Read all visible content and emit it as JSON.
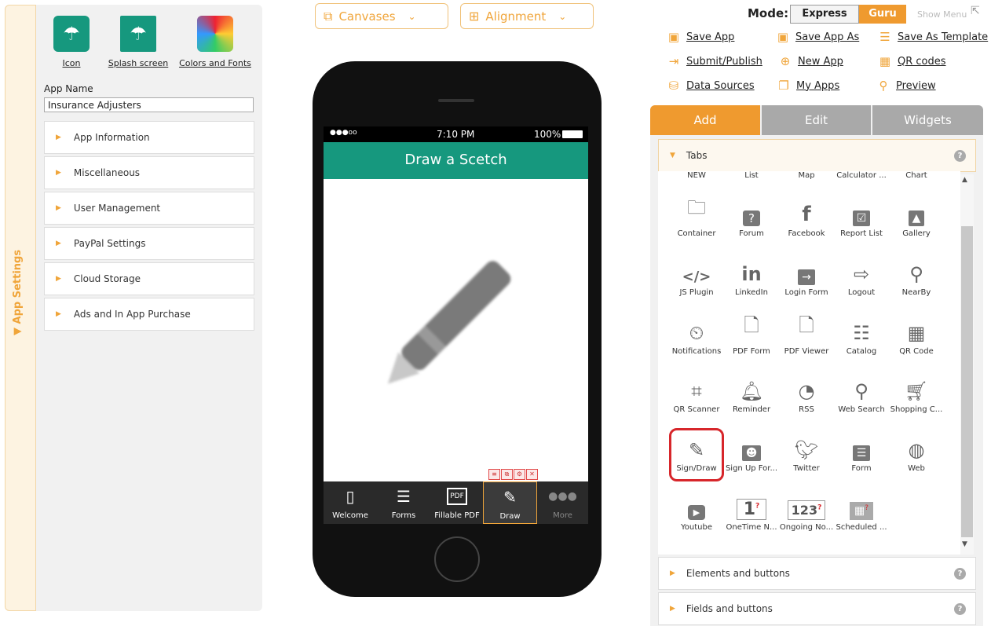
{
  "left_panel": {
    "side_tab_label": "App Settings",
    "tiles": [
      {
        "label": "Icon",
        "icon": "umbrella-icon",
        "color": "#16987e"
      },
      {
        "label": "Splash screen",
        "icon": "umbrella-icon",
        "color": "#16987e"
      },
      {
        "label": "Colors and Fonts",
        "icon": "color-palette-icon",
        "color": "#c86ad8"
      }
    ],
    "app_name_label": "App Name",
    "app_name_value": "Insurance Adjusters",
    "sections": [
      "App Information",
      "Miscellaneous",
      "User Management",
      "PayPal Settings",
      "Cloud Storage",
      "Ads and In App Purchase"
    ]
  },
  "toolbar": {
    "canvases_label": "Canvases",
    "alignment_label": "Alignment"
  },
  "phone": {
    "status_time": "7:10 PM",
    "status_battery": "100%",
    "status_signal": "●●●oo",
    "header_title": "Draw a Scetch",
    "bottom_nav": [
      {
        "label": "Welcome",
        "icon": "phone-icon"
      },
      {
        "label": "Forms",
        "icon": "list-icon"
      },
      {
        "label": "Fillable PDF",
        "icon": "pdf-icon"
      },
      {
        "label": "Draw",
        "icon": "pencil-icon",
        "active": true
      },
      {
        "label": "More",
        "icon": "more-icon"
      }
    ]
  },
  "mode": {
    "label": "Mode:",
    "express": "Express",
    "guru": "Guru",
    "show_menu": "Show Menu"
  },
  "actions": [
    {
      "label": "Save App",
      "icon": "save-icon"
    },
    {
      "label": "Save App As",
      "icon": "save-as-icon"
    },
    {
      "label": "Save As Template",
      "icon": "template-icon"
    },
    {
      "label": "Submit/Publish",
      "icon": "submit-icon"
    },
    {
      "label": "New App",
      "icon": "plus-icon"
    },
    {
      "label": "QR codes",
      "icon": "qr-icon"
    },
    {
      "label": "Data Sources",
      "icon": "database-icon"
    },
    {
      "label": "My Apps",
      "icon": "apps-icon"
    },
    {
      "label": "Preview",
      "icon": "search-icon"
    }
  ],
  "right_panel": {
    "tabs": [
      "Add",
      "Edit",
      "Widgets"
    ],
    "tabs_section_label": "Tabs",
    "items": [
      [
        "NEW",
        "List",
        "Map",
        "Calculator ...",
        "Chart"
      ],
      [
        "Container",
        "Forum",
        "Facebook",
        "Report List",
        "Gallery"
      ],
      [
        "JS Plugin",
        "LinkedIn",
        "Login Form",
        "Logout",
        "NearBy"
      ],
      [
        "Notifications",
        "PDF Form",
        "PDF Viewer",
        "Catalog",
        "QR Code"
      ],
      [
        "QR Scanner",
        "Reminder",
        "RSS",
        "Web Search",
        "Shopping C..."
      ],
      [
        "Sign/Draw",
        "Sign Up For...",
        "Twitter",
        "Form",
        "Web"
      ],
      [
        "Youtube",
        "OneTime N...",
        "Ongoing No...",
        "Scheduled ..."
      ]
    ],
    "elements_label": "Elements and buttons",
    "fields_label": "Fields and buttons"
  }
}
